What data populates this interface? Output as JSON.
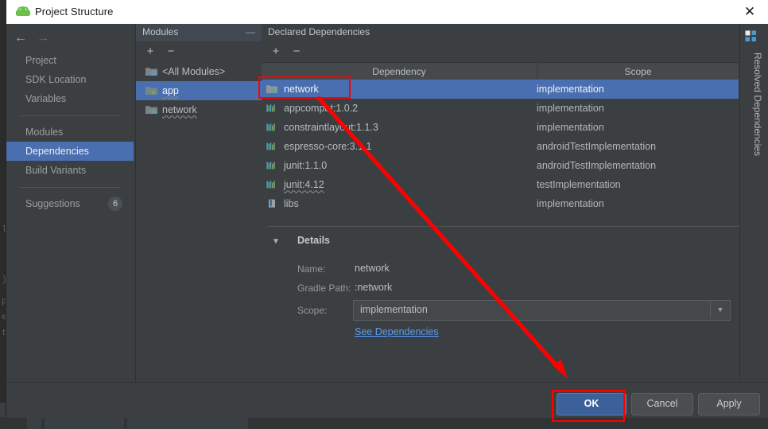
{
  "window": {
    "title": "Project Structure",
    "app_icon": "android-robot-icon",
    "close_label": "✕"
  },
  "left_nav": {
    "back_icon": "←",
    "forward_icon": "→",
    "group1": [
      {
        "label": "Project",
        "selected": false
      },
      {
        "label": "SDK Location",
        "selected": false
      },
      {
        "label": "Variables",
        "selected": false
      }
    ],
    "group2": [
      {
        "label": "Modules",
        "selected": false
      },
      {
        "label": "Dependencies",
        "selected": true
      },
      {
        "label": "Build Variants",
        "selected": false
      }
    ],
    "group3": [
      {
        "label": "Suggestions",
        "selected": false,
        "badge": "6"
      }
    ]
  },
  "modules_panel": {
    "title": "Modules",
    "minimize_icon": "—",
    "add_icon": "+",
    "remove_icon": "−",
    "items": [
      {
        "label": "<All Modules>",
        "icon": "folder-modules-icon",
        "selected": false,
        "wavy": false
      },
      {
        "label": "app",
        "icon": "folder-app-icon",
        "selected": true,
        "wavy": true
      },
      {
        "label": "network",
        "icon": "folder-library-icon",
        "selected": false,
        "wavy": true
      }
    ]
  },
  "dependencies_panel": {
    "title": "Declared Dependencies",
    "add_icon": "+",
    "remove_icon": "−",
    "columns": [
      "Dependency",
      "Scope"
    ],
    "rows": [
      {
        "name": "network",
        "scope": "implementation",
        "icon": "module-lib-icon",
        "selected": true,
        "wavy": false
      },
      {
        "name": "appcompat:1.0.2",
        "scope": "implementation",
        "icon": "library-icon",
        "selected": false,
        "wavy": false
      },
      {
        "name": "constraintlayout:1.1.3",
        "scope": "implementation",
        "icon": "library-icon",
        "selected": false,
        "wavy": false
      },
      {
        "name": "espresso-core:3.1.1",
        "scope": "androidTestImplementation",
        "icon": "library-icon",
        "selected": false,
        "wavy": false
      },
      {
        "name": "junit:1.1.0",
        "scope": "androidTestImplementation",
        "icon": "library-icon",
        "selected": false,
        "wavy": false
      },
      {
        "name": "junit:4.12",
        "scope": "testImplementation",
        "icon": "library-icon",
        "selected": false,
        "wavy": true
      },
      {
        "name": "libs",
        "scope": "implementation",
        "icon": "jar-file-icon",
        "selected": false,
        "wavy": false
      }
    ]
  },
  "details": {
    "header": "Details",
    "collapse_icon": "▼",
    "name_label": "Name:",
    "name_value": "network",
    "gradle_path_label": "Gradle Path:",
    "gradle_path_value": ":network",
    "scope_label": "Scope:",
    "scope_value": "implementation",
    "scope_dropdown_icon": "▼",
    "see_dependencies_link": "See Dependencies"
  },
  "right_tab": {
    "label": "Resolved Dependencies",
    "icon": "resolved-dependencies-icon"
  },
  "footer": {
    "ok_label": "OK",
    "cancel_label": "Cancel",
    "apply_label": "Apply"
  },
  "annotations": {
    "highlight_color": "#ff0000",
    "network_row_box": true,
    "ok_button_box": true,
    "arrow_from_network_to_ok": true
  }
}
